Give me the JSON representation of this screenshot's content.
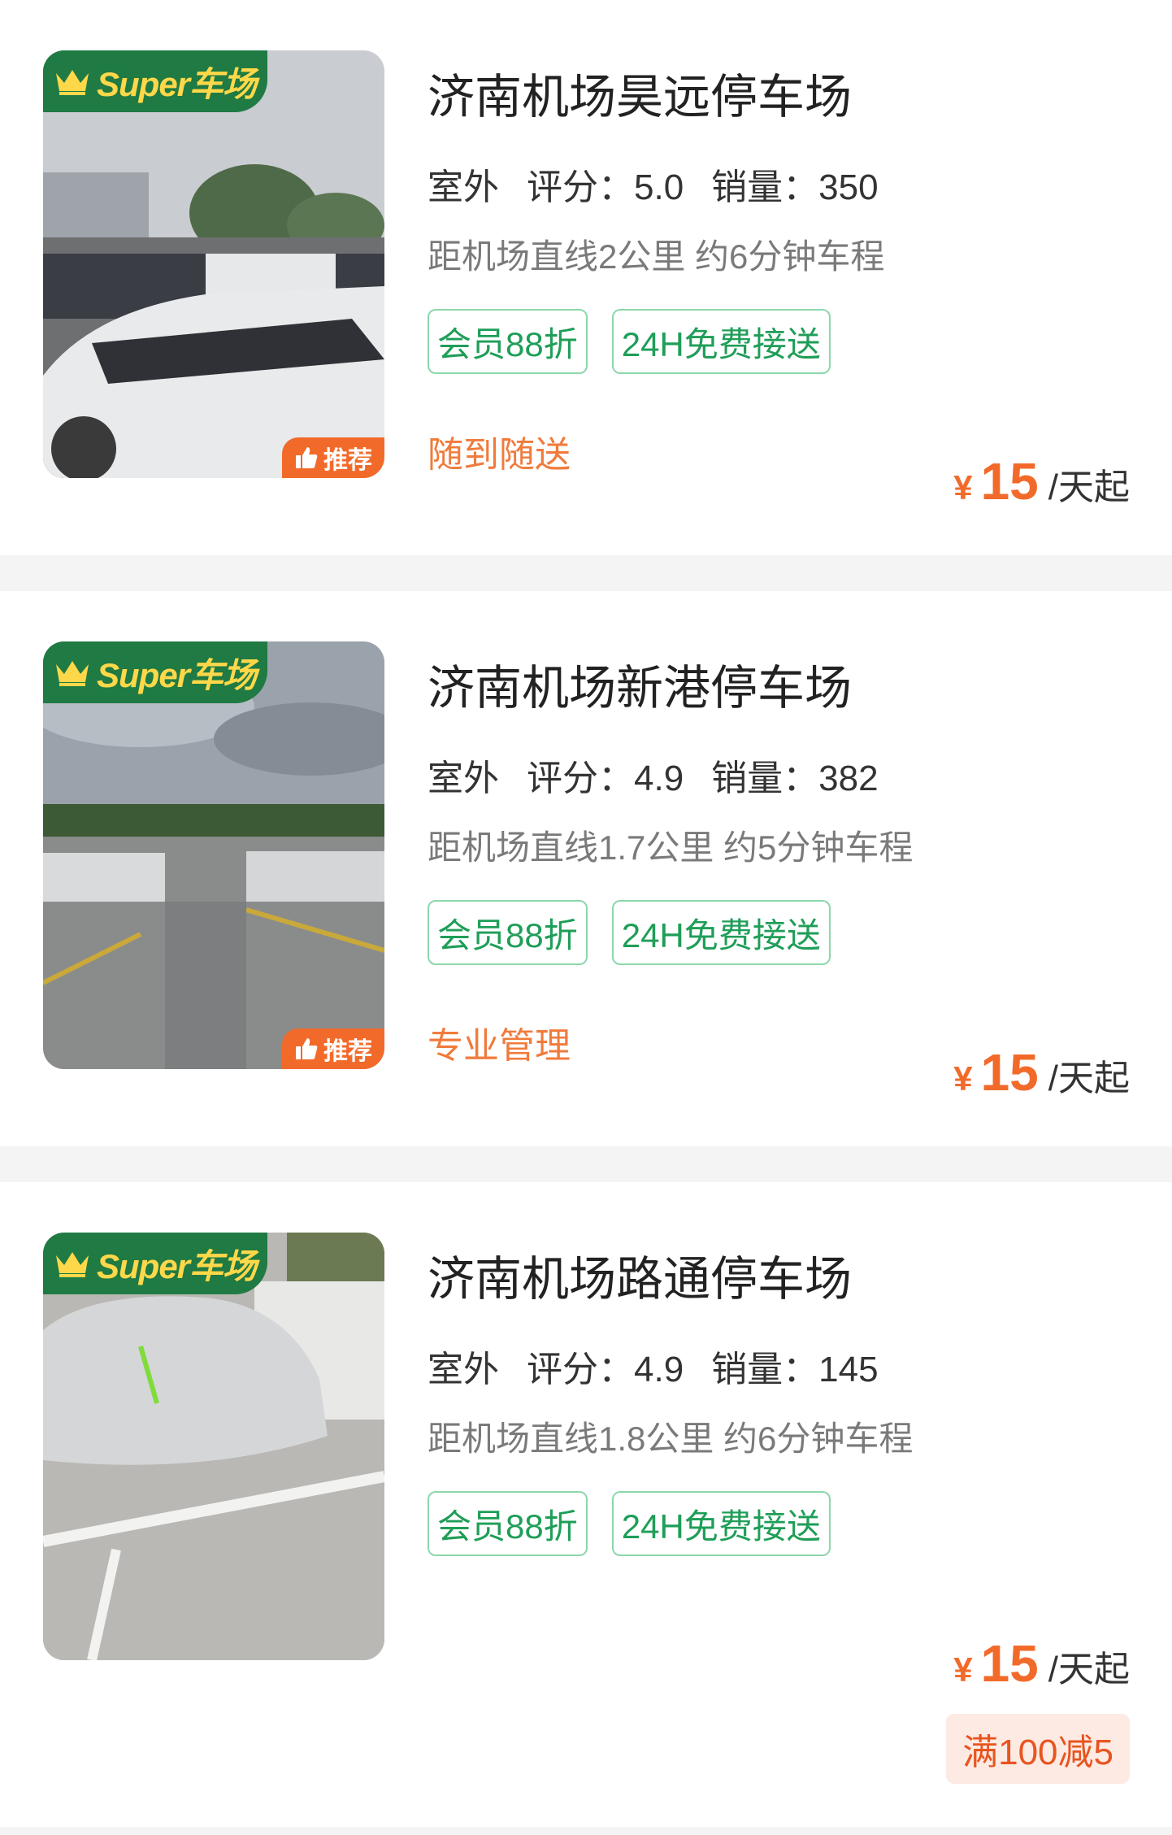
{
  "lots": [
    {
      "badge": "Super车场",
      "recommend": "推荐",
      "title": "济南机场昊远停车场",
      "type": "室外",
      "rating": "评分：5.0",
      "sales": "销量：350",
      "distance": "距机场直线2公里 约6分钟车程",
      "tags": [
        "会员88折",
        "24H免费接送"
      ],
      "feature": "随到随送",
      "price_symbol": "¥",
      "price": "15",
      "price_unit": "/天起"
    },
    {
      "badge": "Super车场",
      "recommend": "推荐",
      "title": "济南机场新港停车场",
      "type": "室外",
      "rating": "评分：4.9",
      "sales": "销量：382",
      "distance": "距机场直线1.7公里 约5分钟车程",
      "tags": [
        "会员88折",
        "24H免费接送"
      ],
      "feature": "专业管理",
      "price_symbol": "¥",
      "price": "15",
      "price_unit": "/天起"
    },
    {
      "badge": "Super车场",
      "title": "济南机场路通停车场",
      "type": "室外",
      "rating": "评分：4.9",
      "sales": "销量：145",
      "distance": "距机场直线1.8公里 约6分钟车程",
      "tags": [
        "会员88折",
        "24H免费接送"
      ],
      "price_symbol": "¥",
      "price": "15",
      "price_unit": "/天起",
      "promo": "满100减5"
    }
  ],
  "colors": {
    "brand_green": "#1f7a43",
    "badge_yellow": "#ffd84a",
    "accent_orange": "#f26a2a",
    "tag_green": "#1f9e58",
    "promo_bg": "#fdeae3"
  },
  "icons": {
    "badge": "crown-icon",
    "recommend": "thumbs-up-icon"
  }
}
